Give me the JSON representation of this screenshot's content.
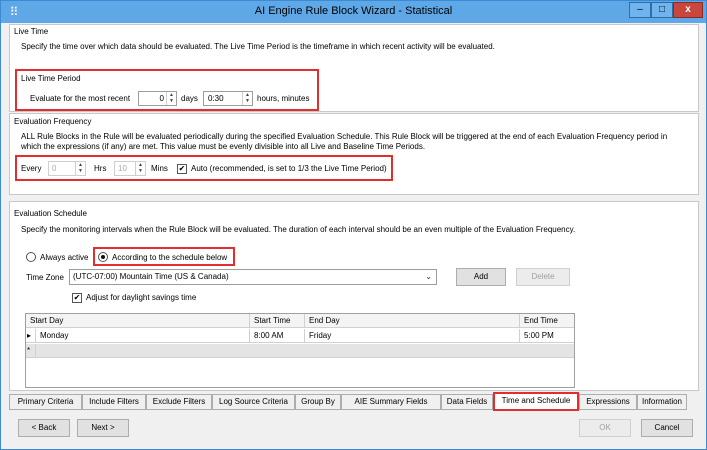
{
  "window": {
    "title": "AI Engine Rule Block Wizard - Statistical",
    "minimize": "–",
    "maximize": "□",
    "close": "x"
  },
  "live_time": {
    "heading": "Live Time",
    "description": "Specify the time over which data should be evaluated. The Live Time Period is the timeframe in which recent activity will be evaluated.",
    "period_heading": "Live Time Period",
    "evaluate_label": "Evaluate for the most recent",
    "days_value": "0",
    "days_label": "days",
    "time_value": "0:30",
    "time_unit_label": "hours, minutes"
  },
  "eval_frequency": {
    "heading": "Evaluation Frequency",
    "description_line1": "ALL Rule Blocks in the Rule will be evaluated periodically during the specified Evaluation Schedule. This Rule Block will be triggered at the end of each Evaluation Frequency period in",
    "description_line2": "which the expressions (if any) are met. This value must be evenly divisible into all Live and Baseline Time Periods.",
    "every_label": "Every",
    "hrs_value": "0",
    "hrs_label": "Hrs",
    "mins_value": "10",
    "mins_label": "Mins",
    "auto_checked": true,
    "auto_label": "Auto (recommended, is set to 1/3 the Live Time Period)"
  },
  "schedule": {
    "heading": "Evaluation Schedule",
    "description": "Specify the monitoring intervals when the Rule Block will be evaluated. The duration of each interval should be an even multiple of the Evaluation Frequency.",
    "always_active_label": "Always active",
    "according_label": "According to the schedule below",
    "time_zone_label": "Time Zone",
    "time_zone_value": "(UTC-07:00) Mountain Time (US & Canada)",
    "add_label": "Add",
    "delete_label": "Delete",
    "dst_checked": true,
    "dst_label": "Adjust for daylight savings time",
    "columns": [
      "Start Day",
      "Start Time",
      "End Day",
      "End Time"
    ],
    "rows": [
      {
        "start_day": "Monday",
        "start_time": "8:00 AM",
        "end_day": "Friday",
        "end_time": "5:00 PM"
      }
    ],
    "new_row_marker": "*",
    "current_row_marker": "▸"
  },
  "tabs": [
    "Primary Criteria",
    "Include Filters",
    "Exclude Filters",
    "Log Source Criteria",
    "Group By",
    "AIE Summary Fields",
    "Data Fields",
    "Time and Schedule",
    "Expressions",
    "Information"
  ],
  "active_tab": "Time and Schedule",
  "footer": {
    "back_label": "< Back",
    "next_label": "Next >",
    "ok_label": "OK",
    "cancel_label": "Cancel"
  },
  "colors": {
    "highlight": "#e0302e",
    "titlebar": "#5fa8e8"
  }
}
